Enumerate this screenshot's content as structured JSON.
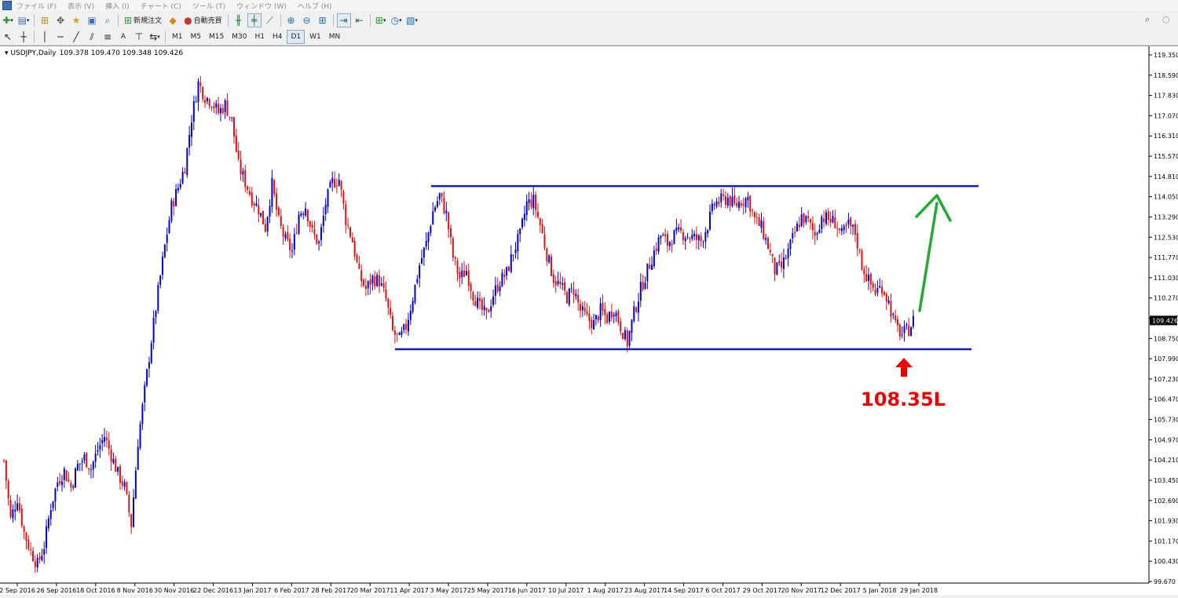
{
  "menu": [
    "ファイル (F)",
    "表示 (V)",
    "挿入 (I)",
    "チャート (C)",
    "ツール (T)",
    "ウィンドウ (W)",
    "ヘルプ (H)"
  ],
  "toolbar": {
    "new_order": "新規注文",
    "auto_trading": "自動売買",
    "timeframes": [
      "M1",
      "M5",
      "M15",
      "M30",
      "H1",
      "H4",
      "D1",
      "W1",
      "MN"
    ],
    "selected_timeframe": "D1",
    "text_label_tool": "A"
  },
  "chart_header": {
    "symbol": "USDJPY,Daily",
    "ohlc": "109.378 109.470 109.348 109.426"
  },
  "colors": {
    "bull": "#0000cc",
    "bear": "#dd1111",
    "channel": "#1a1ab8",
    "arrow_green": "#22aa33",
    "arrow_red": "#ee0000"
  },
  "chart_data": {
    "type": "candlestick",
    "ylim": [
      99.67,
      119.35
    ],
    "y_ticks": [
      "119.350",
      "118.590",
      "117.830",
      "117.070",
      "116.310",
      "115.570",
      "114.810",
      "114.050",
      "113.290",
      "112.530",
      "111.770",
      "111.030",
      "110.270",
      "109.510",
      "108.750",
      "107.990",
      "107.230",
      "106.470",
      "105.730",
      "104.970",
      "104.210",
      "103.450",
      "102.690",
      "101.930",
      "101.170",
      "100.430",
      "99.670"
    ],
    "x_ticks": [
      "2 Sep 2016",
      "26 Sep 2016",
      "18 Oct 2016",
      "8 Nov 2016",
      "30 Nov 2016",
      "22 Dec 2016",
      "13 Jan 2017",
      "6 Feb 2017",
      "28 Feb 2017",
      "20 Mar 2017",
      "11 Apr 2017",
      "3 May 2017",
      "25 May 2017",
      "16 Jun 2017",
      "10 Jul 2017",
      "1 Aug 2017",
      "23 Aug 2017",
      "14 Sep 2017",
      "6 Oct 2017",
      "29 Oct 2017",
      "20 Nov 2017",
      "12 Dec 2017",
      "5 Jan 2018",
      "29 Jan 2018"
    ],
    "current_price": "109.426",
    "price_path": [
      [
        0,
        104.2
      ],
      [
        3,
        102.0
      ],
      [
        6,
        102.8
      ],
      [
        9,
        101.5
      ],
      [
        12,
        100.8
      ],
      [
        15,
        100.3
      ],
      [
        18,
        101.0
      ],
      [
        21,
        102.5
      ],
      [
        24,
        103.4
      ],
      [
        27,
        103.8
      ],
      [
        30,
        103.2
      ],
      [
        33,
        104.0
      ],
      [
        36,
        104.3
      ],
      [
        39,
        103.9
      ],
      [
        42,
        104.6
      ],
      [
        45,
        105.1
      ],
      [
        48,
        104.4
      ],
      [
        51,
        103.7
      ],
      [
        54,
        103.2
      ],
      [
        57,
        101.8
      ],
      [
        60,
        104.9
      ],
      [
        63,
        106.8
      ],
      [
        66,
        108.7
      ],
      [
        69,
        110.5
      ],
      [
        72,
        112.2
      ],
      [
        75,
        113.7
      ],
      [
        78,
        114.4
      ],
      [
        81,
        115.2
      ],
      [
        84,
        117.0
      ],
      [
        87,
        118.3
      ],
      [
        90,
        117.8
      ],
      [
        93,
        117.6
      ],
      [
        96,
        117.2
      ],
      [
        99,
        117.5
      ],
      [
        102,
        116.9
      ],
      [
        105,
        115.2
      ],
      [
        108,
        114.6
      ],
      [
        111,
        114.0
      ],
      [
        114,
        113.6
      ],
      [
        117,
        112.9
      ],
      [
        120,
        114.5
      ],
      [
        123,
        113.1
      ],
      [
        126,
        112.4
      ],
      [
        129,
        112.0
      ],
      [
        132,
        113.4
      ],
      [
        135,
        113.7
      ],
      [
        138,
        112.7
      ],
      [
        141,
        112.3
      ],
      [
        144,
        113.8
      ],
      [
        147,
        114.6
      ],
      [
        150,
        114.7
      ],
      [
        153,
        113.2
      ],
      [
        156,
        112.4
      ],
      [
        159,
        111.1
      ],
      [
        162,
        110.6
      ],
      [
        165,
        111.0
      ],
      [
        168,
        110.9
      ],
      [
        171,
        110.2
      ],
      [
        174,
        109.0
      ],
      [
        177,
        108.7
      ],
      [
        180,
        109.2
      ],
      [
        183,
        110.3
      ],
      [
        186,
        111.5
      ],
      [
        189,
        112.3
      ],
      [
        192,
        113.5
      ],
      [
        195,
        114.1
      ],
      [
        198,
        113.4
      ],
      [
        201,
        111.8
      ],
      [
        204,
        111.0
      ],
      [
        207,
        111.3
      ],
      [
        210,
        110.4
      ],
      [
        213,
        109.9
      ],
      [
        216,
        109.6
      ],
      [
        219,
        110.4
      ],
      [
        222,
        110.9
      ],
      [
        225,
        111.2
      ],
      [
        228,
        112.0
      ],
      [
        231,
        112.6
      ],
      [
        234,
        113.8
      ],
      [
        237,
        113.9
      ],
      [
        240,
        113.0
      ],
      [
        243,
        111.9
      ],
      [
        246,
        111.0
      ],
      [
        249,
        110.7
      ],
      [
        252,
        110.3
      ],
      [
        255,
        110.6
      ],
      [
        258,
        109.8
      ],
      [
        261,
        109.5
      ],
      [
        264,
        109.3
      ],
      [
        267,
        109.8
      ],
      [
        270,
        109.5
      ],
      [
        273,
        109.9
      ],
      [
        276,
        109.2
      ],
      [
        279,
        108.6
      ],
      [
        282,
        109.7
      ],
      [
        285,
        110.6
      ],
      [
        288,
        111.3
      ],
      [
        291,
        112.0
      ],
      [
        294,
        112.6
      ],
      [
        297,
        112.3
      ],
      [
        300,
        112.6
      ],
      [
        303,
        112.7
      ],
      [
        306,
        112.6
      ],
      [
        309,
        112.5
      ],
      [
        312,
        112.4
      ],
      [
        315,
        113.0
      ],
      [
        318,
        113.8
      ],
      [
        321,
        113.9
      ],
      [
        324,
        114.0
      ],
      [
        327,
        113.7
      ],
      [
        330,
        113.9
      ],
      [
        333,
        114.0
      ],
      [
        336,
        113.2
      ],
      [
        339,
        112.9
      ],
      [
        342,
        112.2
      ],
      [
        345,
        111.3
      ],
      [
        348,
        111.4
      ],
      [
        351,
        112.0
      ],
      [
        354,
        112.7
      ],
      [
        357,
        113.3
      ],
      [
        360,
        113.1
      ],
      [
        363,
        112.6
      ],
      [
        366,
        113.3
      ],
      [
        369,
        113.2
      ],
      [
        372,
        113.1
      ],
      [
        375,
        112.6
      ],
      [
        378,
        113.0
      ],
      [
        381,
        112.7
      ],
      [
        384,
        111.5
      ],
      [
        387,
        110.9
      ],
      [
        390,
        110.5
      ],
      [
        393,
        110.7
      ],
      [
        396,
        110.1
      ],
      [
        399,
        109.2
      ],
      [
        402,
        108.9
      ],
      [
        405,
        109.1
      ],
      [
        407,
        109.43
      ]
    ]
  },
  "annotations": {
    "support_label": "108.35L",
    "channel_top": 114.45,
    "channel_bottom": 108.35
  }
}
